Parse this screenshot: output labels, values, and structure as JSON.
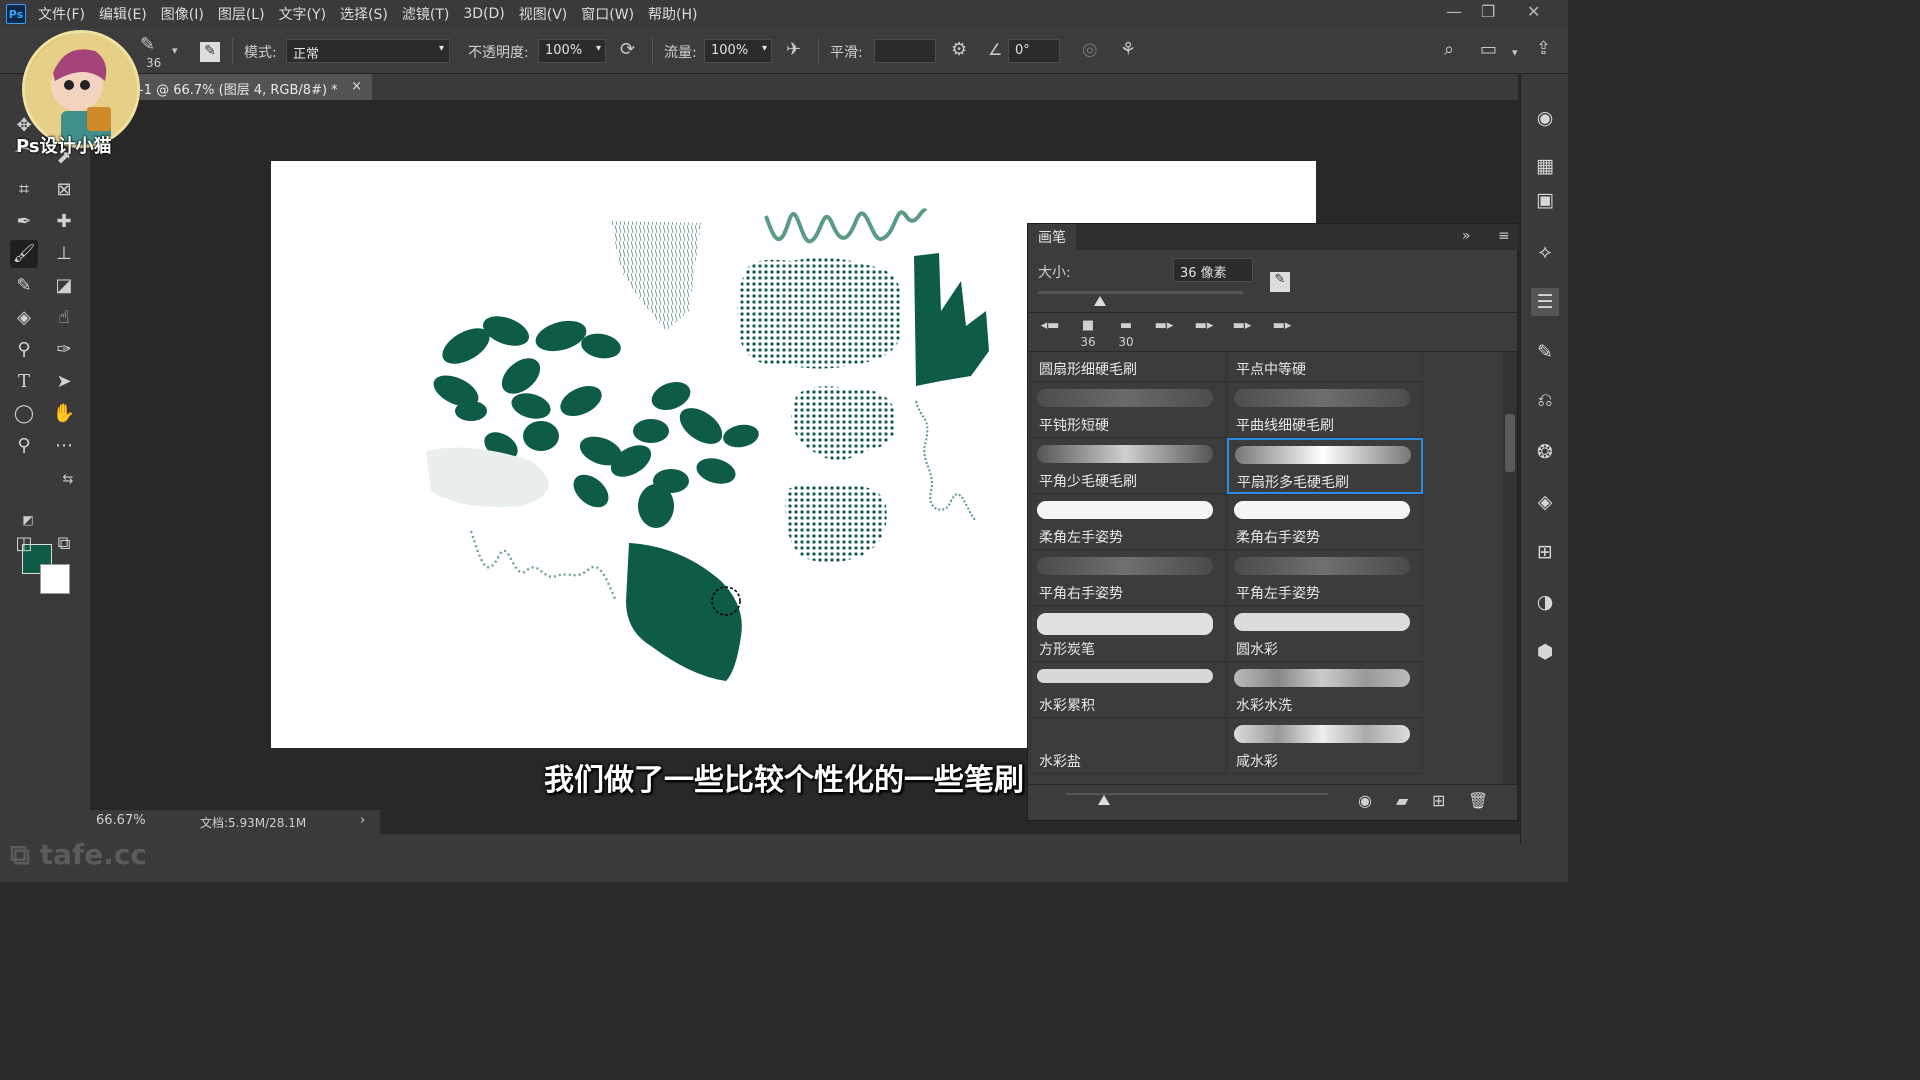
{
  "menubar": {
    "logo": "Ps",
    "items": [
      "文件(F)",
      "编辑(E)",
      "图像(I)",
      "图层(L)",
      "文字(Y)",
      "选择(S)",
      "滤镜(T)",
      "3D(D)",
      "视图(V)",
      "窗口(W)",
      "帮助(H)"
    ],
    "window_controls": [
      "minimize",
      "restore",
      "close"
    ]
  },
  "options": {
    "brush_size": "36",
    "mode_label": "模式:",
    "mode_value": "正常",
    "opacity_label": "不透明度:",
    "opacity_value": "100%",
    "flow_label": "流量:",
    "flow_value": "100%",
    "smooth_label": "平滑:",
    "smooth_value": "",
    "angle_value": "0°"
  },
  "document": {
    "tab_title": "未标题-1 @ 66.7% (图层 4, RGB/8#) *",
    "close": "×",
    "zoom": "66.67%",
    "doc_info": "文档:5.93M/28.1M",
    "status_arrow": "›"
  },
  "colors": {
    "foreground": "#0e5c48",
    "background": "#ffffff",
    "accent": "#2b8ce8"
  },
  "brush_panel": {
    "title": "画笔",
    "size_label": "大小:",
    "size_value": "36 像素",
    "recent_sizes": [
      "36",
      "30",
      "",
      "",
      "",
      ""
    ],
    "brushes": [
      {
        "label": "圆扇形细硬毛刷"
      },
      {
        "label": "平点中等硬"
      },
      {
        "label": "平钝形短硬"
      },
      {
        "label": "平曲线细硬毛刷"
      },
      {
        "label": "平角少毛硬毛刷"
      },
      {
        "label": "平扇形多毛硬毛刷",
        "selected": true
      },
      {
        "label": "柔角左手姿势"
      },
      {
        "label": "柔角右手姿势"
      },
      {
        "label": "平角右手姿势"
      },
      {
        "label": "平角左手姿势"
      },
      {
        "label": "方形炭笔"
      },
      {
        "label": "圆水彩"
      },
      {
        "label": "水彩累积"
      },
      {
        "label": "水彩水洗"
      },
      {
        "label": "水彩盐"
      },
      {
        "label": "咸水彩"
      }
    ]
  },
  "overlay": {
    "subtitle": "我们做了一些比较个性化的一些笔刷",
    "watermark": "tafe.cc",
    "avatar_caption": "Ps设计小猫"
  }
}
